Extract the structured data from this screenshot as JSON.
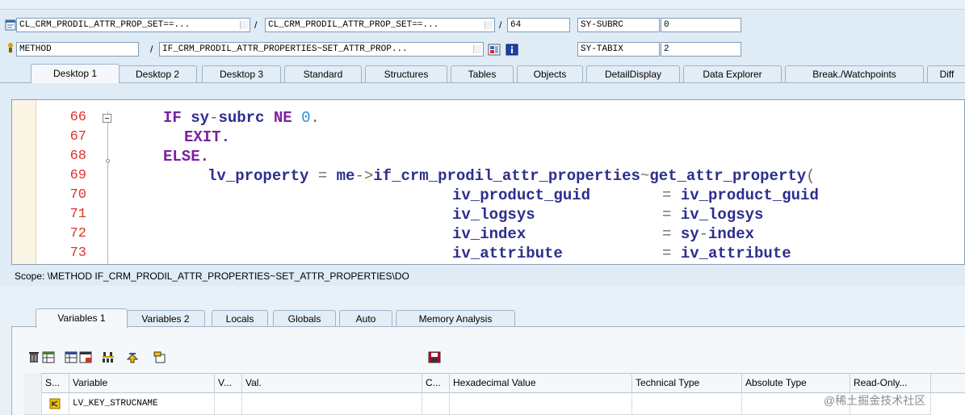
{
  "header": {
    "row1": {
      "program": "CL_CRM_PRODIL_ATTR_PROP_SET==...",
      "include": "CL_CRM_PRODIL_ATTR_PROP_SET==...",
      "line": "64",
      "sysfield_name": "SY-SUBRC",
      "sysfield_value": "0"
    },
    "row2": {
      "event_type": "METHOD",
      "event": "IF_CRM_PRODIL_ATTR_PROPERTIES~SET_ATTR_PROP...",
      "sysfield_name": "SY-TABIX",
      "sysfield_value": "2"
    },
    "separator": "/"
  },
  "desktop_tabs": [
    "Desktop 1",
    "Desktop 2",
    "Desktop 3",
    "Standard",
    "Structures",
    "Tables",
    "Objects",
    "DetailDisplay",
    "Data Explorer",
    "Break./Watchpoints",
    "Diff"
  ],
  "editor": {
    "line_numbers": [
      "66",
      "67",
      "68",
      "69",
      "70",
      "71",
      "72",
      "73"
    ],
    "code": {
      "l66_kw1": "IF ",
      "l66_id": "sy",
      "l66_dash": "-",
      "l66_id2": "subrc ",
      "l66_kw2": "NE ",
      "l66_num": "0",
      "l66_dot": ".",
      "l67": "EXIT.",
      "l68": "ELSE.",
      "l69_a": "lv_property ",
      "l69_eq": "= ",
      "l69_b": "me",
      "l69_arrow": "->",
      "l69_c": "if_crm_prodil_attr_properties",
      "l69_tilde": "~",
      "l69_d": "get_attr_property",
      "l69_paren": "(",
      "l70_a": "iv_product_guid",
      "l70_eq": "= ",
      "l70_b": "iv_product_guid",
      "l71_a": "iv_logsys",
      "l71_eq": "= ",
      "l71_b": "iv_logsys",
      "l72_a": "iv_index",
      "l72_eq": "= ",
      "l72_b": "sy",
      "l72_dash": "-",
      "l72_c": "index",
      "l73_a": "iv_attribute",
      "l73_eq": "= ",
      "l73_b": "iv_attribute"
    }
  },
  "scope": "Scope: \\METHOD IF_CRM_PRODIL_ATTR_PROPERTIES~SET_ATTR_PROPERTIES\\DO",
  "variable_tabs": [
    "Variables 1",
    "Variables 2",
    "Locals",
    "Globals",
    "Auto",
    "Memory Analysis"
  ],
  "grid": {
    "columns": [
      "S...",
      "Variable",
      "V...",
      "Val.",
      "C...",
      "Hexadecimal Value",
      "Technical Type",
      "Absolute Type",
      "Read-Only..."
    ],
    "rows": [
      {
        "variable": "LV_KEY_STRUCNAME"
      }
    ]
  },
  "watermark": "@稀土掘金技术社区",
  "icons": [
    "program-icon",
    "method-icon",
    "layout-icon",
    "info-icon",
    "delete-icon",
    "table-icon",
    "export-icon",
    "settings-icon",
    "hierarchy-icon",
    "navigate-icon",
    "display-icon",
    "save-icon",
    "variable-icon"
  ],
  "colors": {
    "keyword": "#7a1fa2",
    "identifier": "#2c2e8e",
    "line_number": "#e0312b",
    "number": "#2c8fe0"
  }
}
